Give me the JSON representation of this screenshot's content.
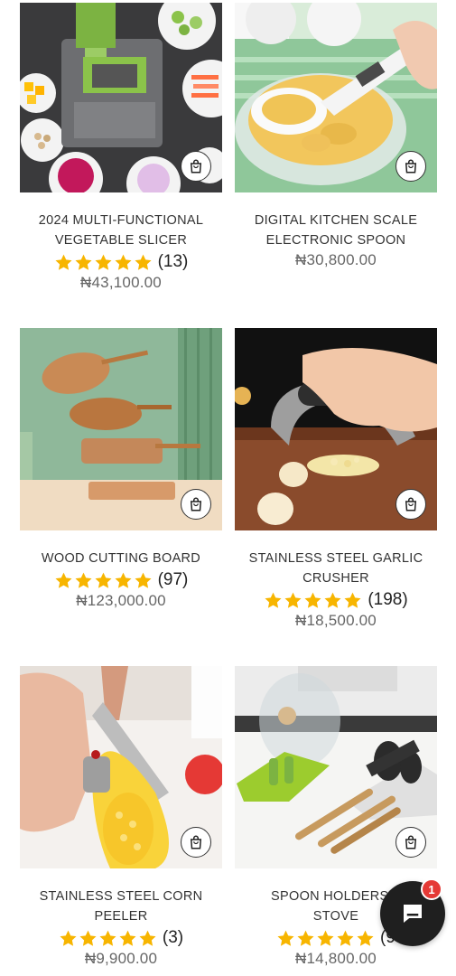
{
  "products": [
    {
      "title_line1": "2024 MULTI-FUNCTIONAL",
      "title_line2": "VEGETABLE SLICER",
      "rating": 5,
      "review_count": "(13)",
      "price": "₦43,100.00",
      "image_icon": "vegetable-slicer-image"
    },
    {
      "title_line1": "DIGITAL KITCHEN SCALE",
      "title_line2": "ELECTRONIC SPOON",
      "rating": 5,
      "review_count": "",
      "price": "₦30,800.00",
      "image_icon": "scale-spoon-image"
    },
    {
      "title_line1": "WOOD CUTTING BOARD",
      "title_line2": "",
      "rating": 5,
      "review_count": "(97)",
      "price": "₦123,000.00",
      "image_icon": "cutting-board-image"
    },
    {
      "title_line1": "STAINLESS STEEL GARLIC",
      "title_line2": "CRUSHER",
      "rating": 5,
      "review_count": "(198)",
      "price": "₦18,500.00",
      "image_icon": "garlic-crusher-image"
    },
    {
      "title_line1": "STAINLESS STEEL CORN",
      "title_line2": "PEELER",
      "rating": 5,
      "review_count": "(3)",
      "price": "₦9,900.00",
      "image_icon": "corn-peeler-image"
    },
    {
      "title_line1": "SPOON HOLDERS F",
      "title_line2": "STOVE",
      "rating": 5,
      "review_count": "(9",
      "price": "₦14,800.00",
      "image_icon": "spoon-holder-image"
    }
  ],
  "chat": {
    "badge_count": "1",
    "icon": "chat-bubble-icon"
  },
  "colors": {
    "star": "#f7b500",
    "badge": "#e53935",
    "chat_bg": "#1f1f1f"
  }
}
